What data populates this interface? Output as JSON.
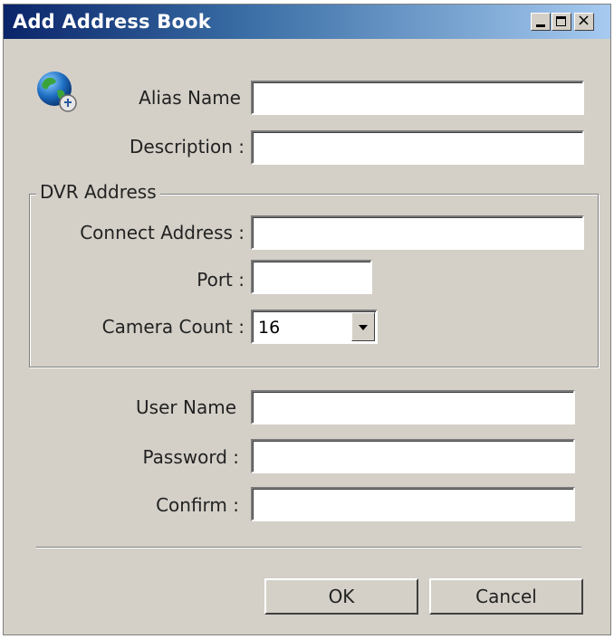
{
  "window": {
    "title": "Add Address Book",
    "minimize_icon": "minimize-icon",
    "maximize_icon": "maximize-icon",
    "close_icon": "close-icon",
    "close_glyph": "×"
  },
  "form": {
    "alias_name": {
      "label": "Alias Name",
      "value": ""
    },
    "description": {
      "label": "Description :",
      "value": ""
    }
  },
  "dvr_address": {
    "legend": "DVR Address",
    "connect_address": {
      "label": "Connect Address :",
      "value": ""
    },
    "port": {
      "label": "Port :",
      "value": ""
    },
    "camera_count": {
      "label": "Camera Count :",
      "value": "16"
    }
  },
  "account": {
    "user_name": {
      "label": "User Name",
      "value": ""
    },
    "password": {
      "label": "Password :",
      "value": ""
    },
    "confirm": {
      "label": "Confirm :",
      "value": ""
    }
  },
  "buttons": {
    "ok": "OK",
    "cancel": "Cancel"
  },
  "icons": {
    "app_icon": "globe-network-icon"
  },
  "colors": {
    "titlebar_start": "#0a246a",
    "titlebar_end": "#a6caf0",
    "dialog_bg": "#d4d0c8"
  }
}
